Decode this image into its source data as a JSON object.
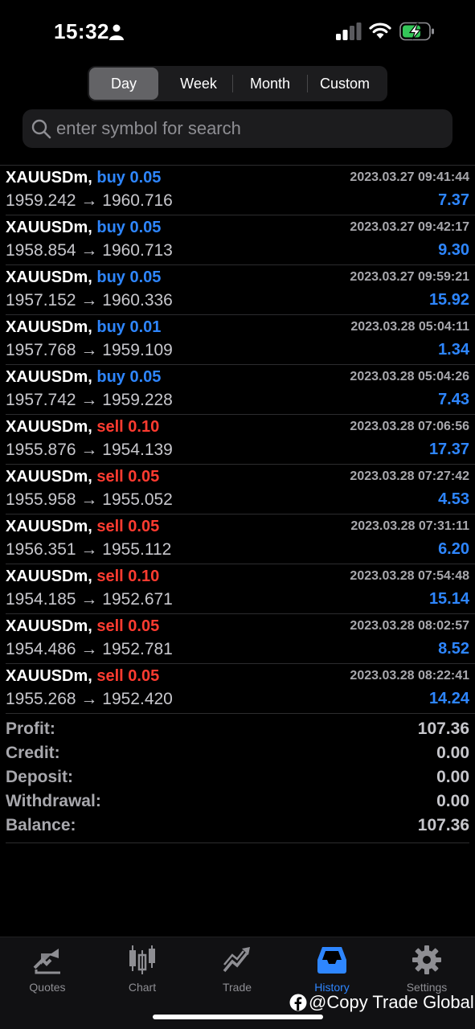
{
  "status_bar": {
    "time": "15:32"
  },
  "periods": {
    "day": "Day",
    "week": "Week",
    "month": "Month",
    "custom": "Custom",
    "selected": "Day"
  },
  "search": {
    "placeholder": "enter symbol for search"
  },
  "deals": [
    {
      "symbol": "XAUUSDm,",
      "direction": "buy",
      "volume": "0.05",
      "open": "1959.242",
      "close": "1960.716",
      "time": "2023.03.27 09:41:44",
      "profit": "7.37"
    },
    {
      "symbol": "XAUUSDm,",
      "direction": "buy",
      "volume": "0.05",
      "open": "1958.854",
      "close": "1960.713",
      "time": "2023.03.27 09:42:17",
      "profit": "9.30"
    },
    {
      "symbol": "XAUUSDm,",
      "direction": "buy",
      "volume": "0.05",
      "open": "1957.152",
      "close": "1960.336",
      "time": "2023.03.27 09:59:21",
      "profit": "15.92"
    },
    {
      "symbol": "XAUUSDm,",
      "direction": "buy",
      "volume": "0.01",
      "open": "1957.768",
      "close": "1959.109",
      "time": "2023.03.28 05:04:11",
      "profit": "1.34"
    },
    {
      "symbol": "XAUUSDm,",
      "direction": "buy",
      "volume": "0.05",
      "open": "1957.742",
      "close": "1959.228",
      "time": "2023.03.28 05:04:26",
      "profit": "7.43"
    },
    {
      "symbol": "XAUUSDm,",
      "direction": "sell",
      "volume": "0.10",
      "open": "1955.876",
      "close": "1954.139",
      "time": "2023.03.28 07:06:56",
      "profit": "17.37"
    },
    {
      "symbol": "XAUUSDm,",
      "direction": "sell",
      "volume": "0.05",
      "open": "1955.958",
      "close": "1955.052",
      "time": "2023.03.28 07:27:42",
      "profit": "4.53"
    },
    {
      "symbol": "XAUUSDm,",
      "direction": "sell",
      "volume": "0.05",
      "open": "1956.351",
      "close": "1955.112",
      "time": "2023.03.28 07:31:11",
      "profit": "6.20"
    },
    {
      "symbol": "XAUUSDm,",
      "direction": "sell",
      "volume": "0.10",
      "open": "1954.185",
      "close": "1952.671",
      "time": "2023.03.28 07:54:48",
      "profit": "15.14"
    },
    {
      "symbol": "XAUUSDm,",
      "direction": "sell",
      "volume": "0.05",
      "open": "1954.486",
      "close": "1952.781",
      "time": "2023.03.28 08:02:57",
      "profit": "8.52"
    },
    {
      "symbol": "XAUUSDm,",
      "direction": "sell",
      "volume": "0.05",
      "open": "1955.268",
      "close": "1952.420",
      "time": "2023.03.28 08:22:41",
      "profit": "14.24"
    }
  ],
  "summary": [
    {
      "label": "Profit:",
      "value": "107.36"
    },
    {
      "label": "Credit:",
      "value": "0.00"
    },
    {
      "label": "Deposit:",
      "value": "0.00"
    },
    {
      "label": "Withdrawal:",
      "value": "0.00"
    },
    {
      "label": "Balance:",
      "value": "107.36"
    }
  ],
  "tabs": [
    {
      "label": "Quotes",
      "icon": "quotes-icon"
    },
    {
      "label": "Chart",
      "icon": "chart-icon"
    },
    {
      "label": "Trade",
      "icon": "trade-icon"
    },
    {
      "label": "History",
      "icon": "history-icon",
      "active": true
    },
    {
      "label": "Settings",
      "icon": "gear-icon"
    }
  ],
  "watermark": "@Copy Trade Global",
  "colors": {
    "buy": "#2e86ff",
    "sell": "#ff3b30",
    "active_tab": "#2e86ff",
    "background": "#000000"
  }
}
